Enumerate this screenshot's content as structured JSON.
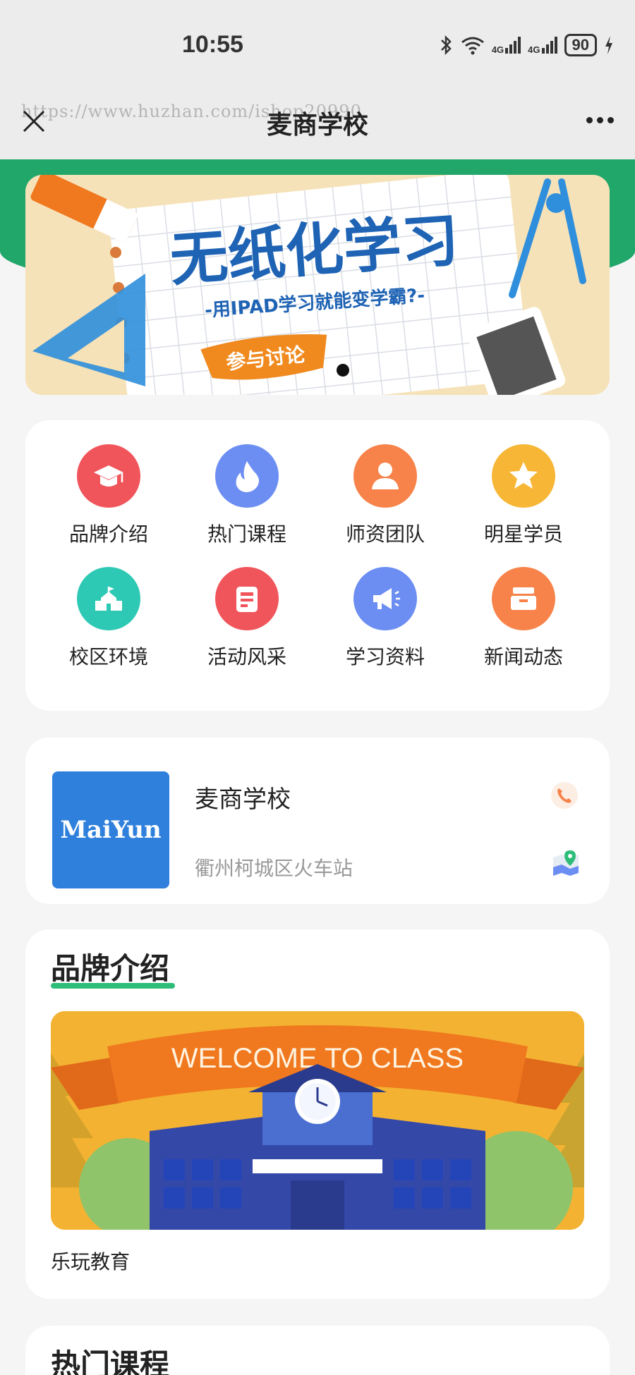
{
  "status_bar": {
    "time": "10:55",
    "battery": "90",
    "network_left": "4G",
    "network_right": "4G"
  },
  "nav": {
    "title": "麦商学校",
    "watermark": "https://www.huzhan.com/ishop20990"
  },
  "banner": {
    "headline": "无纸化学习",
    "subline": "-用IPAD学习就能变学霸?-",
    "button": "参与讨论"
  },
  "menu": {
    "items": [
      {
        "label": "品牌介绍",
        "icon": "graduation-cap-icon",
        "color": "#f0555b"
      },
      {
        "label": "热门课程",
        "icon": "flame-icon",
        "color": "#6c8ef2"
      },
      {
        "label": "师资团队",
        "icon": "person-icon",
        "color": "#f7834a"
      },
      {
        "label": "明星学员",
        "icon": "star-icon",
        "color": "#f7b635"
      },
      {
        "label": "校区环境",
        "icon": "school-building-icon",
        "color": "#2ec9b4"
      },
      {
        "label": "活动风采",
        "icon": "document-icon",
        "color": "#f0555b"
      },
      {
        "label": "学习资料",
        "icon": "megaphone-icon",
        "color": "#6c8ef2"
      },
      {
        "label": "新闻动态",
        "icon": "inbox-tray-icon",
        "color": "#f7834a"
      }
    ]
  },
  "school": {
    "logo_text": "MaiYun",
    "name": "麦商学校",
    "address": "衢州柯城区火车站"
  },
  "brand": {
    "title": "品牌介绍",
    "image_text": "WELCOME TO CLASS",
    "caption": "乐玩教育"
  },
  "hot": {
    "title": "热门课程"
  },
  "colors": {
    "accent_green": "#22a76a",
    "underline_green": "#2dbd79",
    "logo_blue": "#2f80dc"
  }
}
